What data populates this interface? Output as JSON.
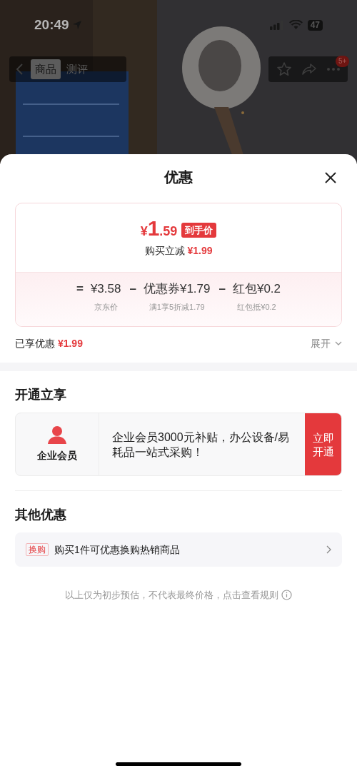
{
  "status_bar": {
    "time": "20:49",
    "battery": "47"
  },
  "nav": {
    "tabs": [
      {
        "label": "商品",
        "selected": true
      },
      {
        "label": "测评",
        "selected": false
      }
    ],
    "badge": "5+"
  },
  "sheet": {
    "title": "优惠",
    "price": {
      "symbol": "¥",
      "integer": "1",
      "decimal": ".59",
      "tag": "到手价"
    },
    "reduction": {
      "label": "购买立减",
      "amount": "¥1.99"
    },
    "breakdown": [
      {
        "operator": "=",
        "text": "¥3.58",
        "caption": "京东价"
      },
      {
        "operator": "–",
        "text": "优惠券¥1.79",
        "caption": "满1享5折减1.79"
      },
      {
        "operator": "–",
        "text": "红包¥0.2",
        "caption": "红包抵¥0.2"
      }
    ],
    "enjoyed": {
      "label": "已享优惠",
      "amount": "¥1.99"
    },
    "expand": "展开",
    "membership": {
      "title": "开通立享",
      "name": "企业会员",
      "description": "企业会员3000元补贴，办公设备/易耗品一站式采购！",
      "button": "立即开通"
    },
    "other": {
      "title": "其他优惠",
      "items": [
        {
          "tag": "换购",
          "text": "购买1件可优惠换购热销商品"
        }
      ]
    },
    "footer": "以上仅为初步预估，不代表最终价格，点击查看规则"
  }
}
